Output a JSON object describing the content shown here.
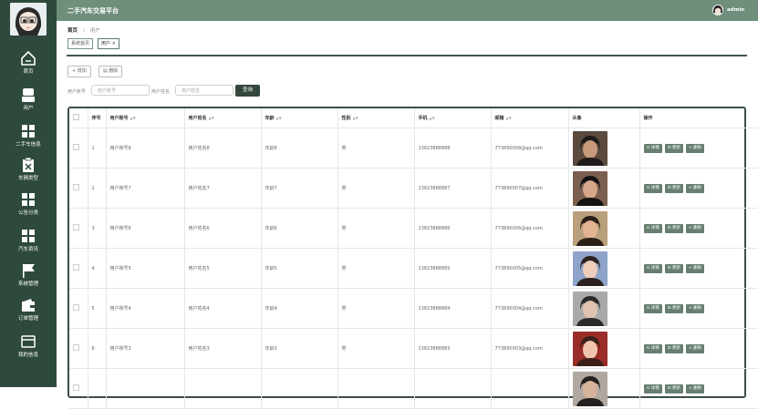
{
  "header": {
    "app_title": "二手汽车交易平台",
    "user_name": "admin"
  },
  "sidebar": {
    "items": [
      {
        "label": "首页",
        "icon": "home-icon"
      },
      {
        "label": "用户",
        "icon": "user-icon"
      },
      {
        "label": "二手车信息",
        "icon": "grid-icon"
      },
      {
        "label": "车辆类型",
        "icon": "clipboard-x-icon"
      },
      {
        "label": "公告分类",
        "icon": "grid-icon"
      },
      {
        "label": "汽车资讯",
        "icon": "grid-icon"
      },
      {
        "label": "系统管理",
        "icon": "flag-icon"
      },
      {
        "label": "订单管理",
        "icon": "wallet-icon"
      },
      {
        "label": "我的信息",
        "icon": "card-icon"
      }
    ]
  },
  "breadcrumb": {
    "home": "首页",
    "separator": "/",
    "current": "用户"
  },
  "tabs": [
    {
      "label": "系统首页",
      "active": false
    },
    {
      "label": "用户 ×",
      "active": true
    }
  ],
  "toolbar": {
    "add_label": "+ 增加",
    "delete_label": "删除"
  },
  "search": {
    "account_label": "用户账号",
    "account_placeholder": "用户账号",
    "name_label": "用户姓名",
    "name_placeholder": "用户姓名",
    "query_label": "查询"
  },
  "table": {
    "columns": [
      "",
      "序号",
      "用户账号",
      "用户姓名",
      "年龄",
      "性别",
      "手机",
      "邮箱",
      "头像",
      "操作"
    ],
    "sortable": [
      false,
      false,
      true,
      true,
      true,
      true,
      true,
      true,
      false,
      false
    ],
    "rows": [
      {
        "index": "1",
        "account": "用户账号8",
        "name": "用户姓名8",
        "age": "年龄8",
        "gender": "男",
        "phone": "13823888888",
        "email": "773890008@qq.com"
      },
      {
        "index": "2",
        "account": "用户账号7",
        "name": "用户姓名7",
        "age": "年龄7",
        "gender": "男",
        "phone": "13823888887",
        "email": "773890007@qq.com"
      },
      {
        "index": "3",
        "account": "用户账号6",
        "name": "用户姓名6",
        "age": "年龄6",
        "gender": "男",
        "phone": "13823888886",
        "email": "773890006@qq.com"
      },
      {
        "index": "4",
        "account": "用户账号5",
        "name": "用户姓名5",
        "age": "年龄5",
        "gender": "男",
        "phone": "13823888885",
        "email": "773890005@qq.com"
      },
      {
        "index": "5",
        "account": "用户账号4",
        "name": "用户姓名4",
        "age": "年龄4",
        "gender": "男",
        "phone": "13823888884",
        "email": "773890004@qq.com"
      },
      {
        "index": "6",
        "account": "用户账号3",
        "name": "用户姓名3",
        "age": "年龄3",
        "gender": "男",
        "phone": "13823888883",
        "email": "773890003@qq.com"
      },
      {
        "index": "",
        "account": "",
        "name": "",
        "age": "",
        "gender": "",
        "phone": "",
        "email": ""
      }
    ],
    "actions": {
      "detail": "⊙ 详情",
      "update": "⊡ 更新",
      "delete": "× 删除"
    }
  },
  "colors": {
    "sidebar_bg": "#2e4a3c",
    "header_bg": "#6f8f7c",
    "button_bg": "#667f71",
    "query_bg": "#33473d"
  }
}
